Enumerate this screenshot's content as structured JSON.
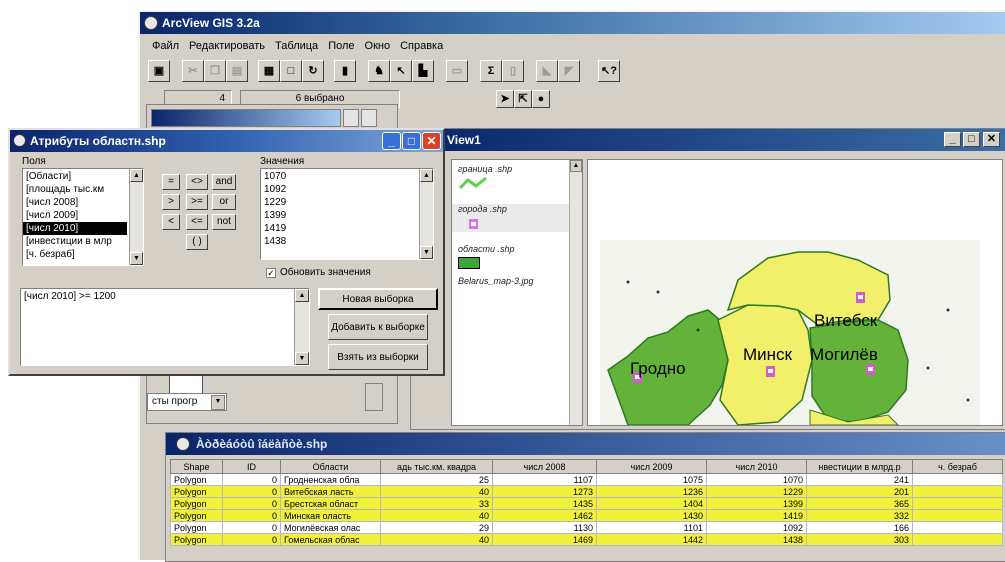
{
  "main_window": {
    "title": "ArcView GIS 3.2a"
  },
  "menu": [
    "Файл",
    "Редактировать",
    "Таблица",
    "Поле",
    "Окно",
    "Справка"
  ],
  "status": {
    "count": "4",
    "selected": "6 выбрано"
  },
  "toolbar_icons": [
    "save-icon",
    "cut-icon",
    "copy-icon",
    "paste-icon",
    "table-icon",
    "blank-icon",
    "refresh-icon",
    "stats-icon",
    "find-icon",
    "query-icon",
    "chart-icon",
    "field-icon",
    "sum-icon",
    "sort-icon",
    "promote-icon",
    "clear-icon",
    "help-icon",
    "pointer-icon",
    "select-tool-icon",
    "info-icon"
  ],
  "view1": {
    "title": "View1",
    "layers": [
      "граница .shp",
      "города .shp",
      "области .shp",
      "Belarus_map-3.jpg"
    ],
    "city_labels": {
      "grodno": "Гродно",
      "minsk": "Минск",
      "mogilev": "Могилёв",
      "vitebsk": "Витебск"
    }
  },
  "project_window": {
    "combo_text": "сты прогр"
  },
  "dialog": {
    "title": "Атрибуты областн.shp",
    "fields_label": "Поля",
    "fields": [
      "[Области]",
      "[площадь тыс.км",
      "[числ 2008]",
      "[числ 2009]",
      "[числ 2010]",
      "[инвестиции в млр",
      "[ч. безраб]"
    ],
    "selected_field": 4,
    "values_label": "Значения",
    "values": [
      "1070",
      "1092",
      "1229",
      "1399",
      "1419",
      "1438"
    ],
    "operators": [
      "=",
      "<>",
      "and",
      ">",
      ">=",
      "or",
      "<",
      "<=",
      "not",
      "( )"
    ],
    "update_checkbox": "Обновить значения",
    "update_checked": true,
    "expression": "[числ 2010] >= 1200",
    "buttons": {
      "new_set": "Новая выборка",
      "add_to_set": "Добавить к выборке",
      "select_from_set": "Взять из выборки"
    }
  },
  "table": {
    "title": "Àòðèáóòû îáëàñòè.shp",
    "columns": [
      "Shape",
      "ID",
      "Области",
      "адь тыс.км. квадра",
      "числ 2008",
      "числ 2009",
      "числ 2010",
      "нвестиции в млрд.р",
      "ч. безраб"
    ],
    "rows": [
      {
        "highlighted": false,
        "cells": [
          "Polygon",
          "0",
          "Гродненская обла",
          "25",
          "1107",
          "1075",
          "1070",
          "241",
          ""
        ]
      },
      {
        "highlighted": true,
        "cells": [
          "Polygon",
          "0",
          "Витебская ласть",
          "40",
          "1273",
          "1236",
          "1229",
          "201",
          ""
        ]
      },
      {
        "highlighted": true,
        "cells": [
          "Polygon",
          "0",
          "Брестская област",
          "33",
          "1435",
          "1404",
          "1399",
          "365",
          ""
        ]
      },
      {
        "highlighted": true,
        "cells": [
          "Polygon",
          "0",
          "Минская оласть",
          "40",
          "1462",
          "1430",
          "1419",
          "332",
          ""
        ]
      },
      {
        "highlighted": false,
        "cells": [
          "Polygon",
          "0",
          "Могилёвская олас",
          "29",
          "1130",
          "1101",
          "1092",
          "166",
          ""
        ]
      },
      {
        "highlighted": true,
        "cells": [
          "Polygon",
          "0",
          "Гомельская облас",
          "40",
          "1469",
          "1442",
          "1438",
          "303",
          ""
        ]
      }
    ]
  },
  "colors": {
    "highlight": "#f1f13a",
    "region_green": "#63b33a",
    "region_yellow": "#f2ef6a",
    "title_blue": "#0a246a"
  }
}
